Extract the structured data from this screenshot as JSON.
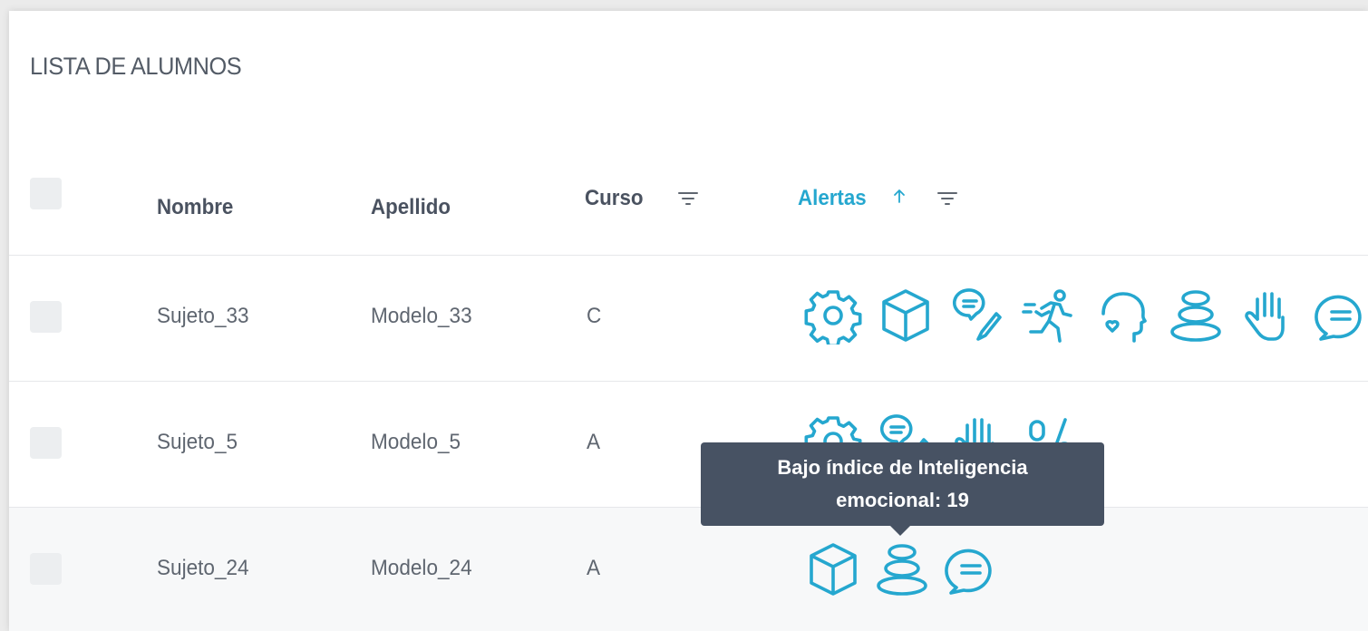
{
  "title": "LISTA DE ALUMNOS",
  "columns": {
    "nombre": "Nombre",
    "apellido": "Apellido",
    "curso": "Curso",
    "alertas": "Alertas"
  },
  "sort": {
    "column": "alertas",
    "direction": "asc",
    "icon": "arrow-up-icon"
  },
  "accent_color": "#25a7cf",
  "rows": [
    {
      "nombre": "Sujeto_33",
      "apellido": "Modelo_33",
      "curso": "C",
      "alerts": [
        "gear-icon",
        "cube-icon",
        "speech-pencil-icon",
        "running-person-icon",
        "head-heart-icon",
        "stacked-stones-icon",
        "raised-hand-icon",
        "speech-bubble-icon"
      ]
    },
    {
      "nombre": "Sujeto_5",
      "apellido": "Modelo_5",
      "curso": "A",
      "alerts": [
        "gear-icon",
        "speech-pencil-icon",
        "raised-hand-icon",
        "percent-icon"
      ]
    },
    {
      "nombre": "Sujeto_24",
      "apellido": "Modelo_24",
      "curso": "A",
      "alerts": [
        "cube-icon",
        "stacked-stones-icon",
        "speech-bubble-icon"
      ]
    }
  ],
  "tooltip": {
    "line1": "Bajo índice de Inteligencia",
    "line2": "emocional: 19"
  }
}
